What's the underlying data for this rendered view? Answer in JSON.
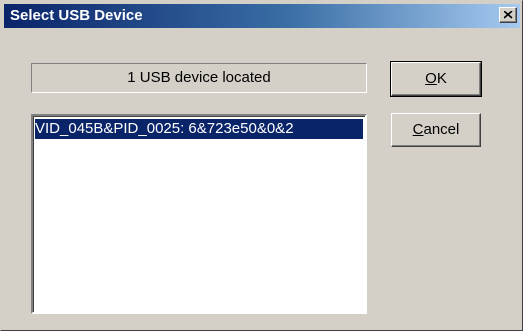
{
  "window": {
    "title": "Select USB Device"
  },
  "status": {
    "text": "1 USB device located"
  },
  "device_list": {
    "items": [
      {
        "label": "VID_045B&PID_0025: 6&723e50&0&2",
        "selected": true
      }
    ]
  },
  "buttons": {
    "ok_accel": "O",
    "ok_rest": "K",
    "cancel_accel": "C",
    "cancel_rest": "ancel"
  },
  "icons": {
    "close": "close-icon"
  },
  "colors": {
    "titlebar_start": "#0a246a",
    "titlebar_end": "#a6caf0",
    "selection": "#0a246a",
    "face": "#d4d0c8"
  }
}
